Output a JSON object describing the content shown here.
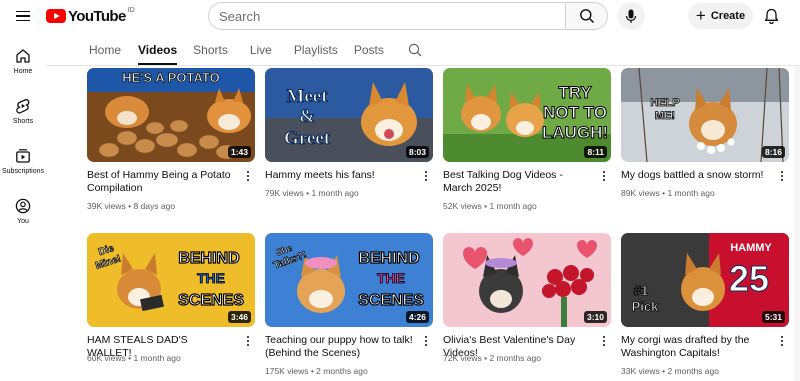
{
  "header": {
    "logo_text": "YouTube",
    "logo_country": "ID",
    "search_placeholder": "Search",
    "create_label": "Create"
  },
  "sidebar": {
    "items": [
      {
        "label": "Home",
        "icon": "home-icon"
      },
      {
        "label": "Shorts",
        "icon": "shorts-icon"
      },
      {
        "label": "Subscriptions",
        "icon": "subscriptions-icon"
      },
      {
        "label": "You",
        "icon": "you-icon"
      }
    ]
  },
  "tabs": [
    {
      "label": "Home",
      "active": false
    },
    {
      "label": "Videos",
      "active": true
    },
    {
      "label": "Shorts",
      "active": false
    },
    {
      "label": "Live",
      "active": false
    },
    {
      "label": "Playlists",
      "active": false
    },
    {
      "label": "Posts",
      "active": false
    }
  ],
  "videos": [
    {
      "title": "Best of Hammy Being a Potato Compilation",
      "views": "39K views",
      "age": "8 days ago",
      "duration": "1:43",
      "thumb_text": [
        "HE'S A POTATO"
      ],
      "thumb_bg": "#e8a33c"
    },
    {
      "title": "Hammy meets his fans!",
      "views": "79K views",
      "age": "1 month ago",
      "duration": "8:03",
      "thumb_text": [
        "Meet",
        "&",
        "Greet"
      ],
      "thumb_bg": "#3d6fb8"
    },
    {
      "title": "Best Talking Dog Videos - March 2025!",
      "views": "52K views",
      "age": "1 month ago",
      "duration": "8:11",
      "thumb_text": [
        "TRY",
        "NOT TO",
        "LAUGH!"
      ],
      "thumb_bg": "#5a9a3c"
    },
    {
      "title": "My dogs battled a snow storm!",
      "views": "89K views",
      "age": "1 month ago",
      "duration": "8:16",
      "thumb_text": [
        "HELP",
        "ME!"
      ],
      "thumb_bg": "#c9cfd4"
    },
    {
      "title": "HAM STEALS DAD'S WALLET!",
      "views": "60K views",
      "age": "1 month ago",
      "duration": "3:46",
      "thumb_text": [
        "Die",
        "Mine!",
        "BEHIND",
        "THE",
        "SCENES"
      ],
      "thumb_bg": "#f2c12e"
    },
    {
      "title": "Teaching our puppy how to talk! (Behind the Scenes)",
      "views": "175K views",
      "age": "2 months ago",
      "duration": "4:26",
      "thumb_text": [
        "She",
        "Talks?!",
        "BEHIND",
        "THE",
        "SCENES"
      ],
      "thumb_bg": "#3f7fd0"
    },
    {
      "title": "Olivia's Best Valentine's Day Videos!",
      "views": "72K views",
      "age": "2 months ago",
      "duration": "3:10",
      "thumb_text": [],
      "thumb_bg": "#f3c6cf"
    },
    {
      "title": "My corgi was drafted by the Washington Capitals!",
      "views": "33K views",
      "age": "2 months ago",
      "duration": "5:31",
      "thumb_text": [
        "HAMMY",
        "25",
        "#1",
        "Pick"
      ],
      "thumb_bg": "#3a3a3a"
    }
  ],
  "colors": {
    "brand_red": "#ff0000",
    "text_primary": "#0f0f0f",
    "text_secondary": "#606060"
  }
}
